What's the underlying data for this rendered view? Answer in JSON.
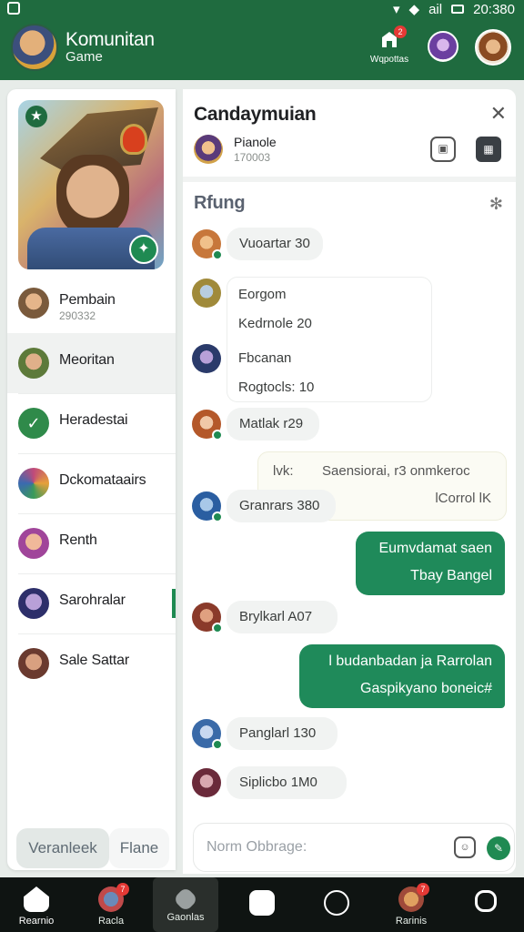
{
  "status_bar": {
    "time": "20:380",
    "carrier": "ail"
  },
  "app": {
    "title": "Komunitan",
    "subtitle": "Game"
  },
  "header": {
    "notifications_label": "Wqpottas",
    "notifications_badge": "2"
  },
  "sidebar": {
    "items": [
      {
        "label": "Pembain",
        "sub": "290332",
        "avatar_color": "#7a5a3c"
      },
      {
        "label": "Meoritan",
        "sub": "",
        "avatar_color": "#5d7a3a"
      },
      {
        "label": "Heradestai",
        "sub": "",
        "avatar_color": "#2f8a4a"
      },
      {
        "label": "Dckomataairs",
        "sub": "",
        "avatar_color": "#b04a6a"
      },
      {
        "label": "Renth",
        "sub": "",
        "avatar_color": "#a0459a"
      },
      {
        "label": "Sarohralar",
        "sub": "",
        "avatar_color": "#2d2f6a"
      },
      {
        "label": "Sale Sattar",
        "sub": "",
        "avatar_color": "#6a3a2f"
      }
    ]
  },
  "chat": {
    "title": "Candaymuian",
    "user_name": "Pianole",
    "user_id": "170003",
    "section_title": "Rfung",
    "messages": [
      {
        "name": "Vuoartar",
        "val": "30",
        "avatar_color": "#c7773b"
      },
      {
        "card_line1": "Eorgom",
        "card_line2": "Kedrnole 20",
        "card_line3": "Fbcanan",
        "card_line4": "Rogtocls: 10"
      },
      {
        "name": "Matlak",
        "val": "r29",
        "avatar_color": "#b4582a"
      },
      {
        "sys_a": "lvk:",
        "sys_b": "Saensiorai, r3 onmkeroc",
        "sys_c": "lCorrol lK"
      },
      {
        "name": "Granrars",
        "val": "380",
        "avatar_color": "#2a5ea1"
      },
      {
        "out1_l1": "Eumvdamat saen",
        "out1_l2": "Tbay Bangel"
      },
      {
        "name": "Brylkarl",
        "val": "A07",
        "avatar_color": "#8a3a2a"
      },
      {
        "out2_l1": "l budanbadan ja Rarrolan",
        "out2_l2": "Gaspikyano boneic#"
      },
      {
        "name": "Panglarl",
        "val": "130",
        "avatar_color": "#3a6aa8"
      },
      {
        "name": "Siplicbo",
        "val": "1M0",
        "avatar_color": "#6a2a3a"
      }
    ]
  },
  "pills": {
    "selected": "Veranleek",
    "other": "Flane"
  },
  "composer": {
    "placeholder": "Norm Obbrage:"
  },
  "nav": {
    "items": [
      {
        "label": "Rearnio",
        "badge": ""
      },
      {
        "label": "Racla",
        "badge": "7"
      },
      {
        "label": "Gaonlas",
        "badge": ""
      },
      {
        "label": "",
        "badge": ""
      },
      {
        "label": "",
        "badge": ""
      },
      {
        "label": "Rarinis",
        "badge": "7"
      },
      {
        "label": "",
        "badge": ""
      }
    ]
  }
}
